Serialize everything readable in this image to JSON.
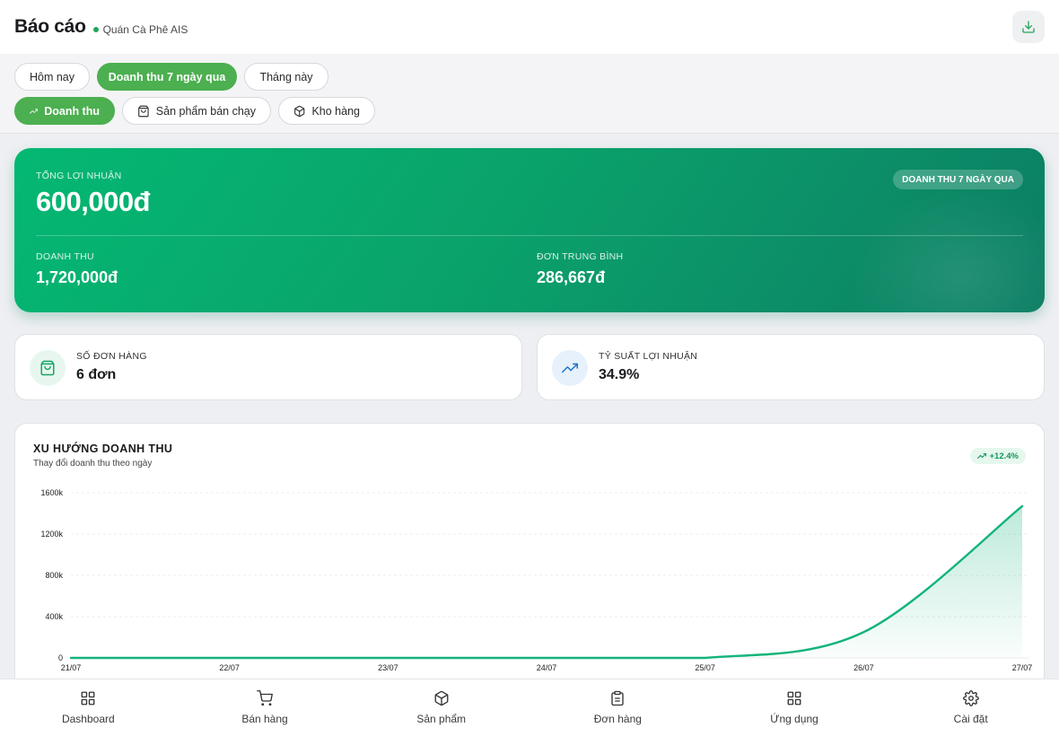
{
  "header": {
    "title": "Báo cáo",
    "store_name": "Quán Cà Phê AIS",
    "store_status_color": "#22a65a",
    "download_icon": "download-icon"
  },
  "filters": {
    "periods": [
      {
        "label": "Hôm nay",
        "active": false
      },
      {
        "label": "Doanh thu 7 ngày qua",
        "active": true
      },
      {
        "label": "Tháng này",
        "active": false
      }
    ],
    "report_tabs": [
      {
        "label": "Doanh thu",
        "icon": "trending-up-icon",
        "active": true
      },
      {
        "label": "Sản phẩm bán chạy",
        "icon": "shopping-bag-icon",
        "active": false
      },
      {
        "label": "Kho hàng",
        "icon": "package-icon",
        "active": false
      }
    ]
  },
  "summary": {
    "profit_label": "Tổng lợi nhuận",
    "profit_value": "600,000đ",
    "period_badge": "DOANH THU 7 NGÀY QUA",
    "revenue_label": "Doanh thu",
    "revenue_value": "1,720,000đ",
    "avg_order_label": "Đơn trung bình",
    "avg_order_value": "286,667đ"
  },
  "stats": {
    "orders_label": "Số đơn hàng",
    "orders_value": "6 đơn",
    "margin_label": "Tỷ suất lợi nhuận",
    "margin_value": "34.9%"
  },
  "chart": {
    "title": "Xu hướng doanh thu",
    "subtitle": "Thay đổi doanh thu theo ngày",
    "trend_badge": "+12.4%",
    "accent": "#13b47a"
  },
  "chart_data": {
    "type": "area",
    "x": [
      "21/07",
      "22/07",
      "23/07",
      "24/07",
      "25/07",
      "26/07",
      "27/07"
    ],
    "values": [
      0,
      0,
      0,
      0,
      0,
      250000,
      1470000
    ],
    "y_ticks": [
      "0",
      "400k",
      "800k",
      "1200k",
      "1600k"
    ],
    "ylim": [
      0,
      1600000
    ],
    "grid": true,
    "series_color": "#13b47a"
  },
  "nav": [
    {
      "label": "Dashboard",
      "icon": "grid-icon"
    },
    {
      "label": "Bán hàng",
      "icon": "cart-icon"
    },
    {
      "label": "Sản phẩm",
      "icon": "box-icon"
    },
    {
      "label": "Đơn hàng",
      "icon": "clipboard-icon"
    },
    {
      "label": "Ứng dụng",
      "icon": "apps-icon"
    },
    {
      "label": "Cài đặt",
      "icon": "settings-icon"
    }
  ]
}
